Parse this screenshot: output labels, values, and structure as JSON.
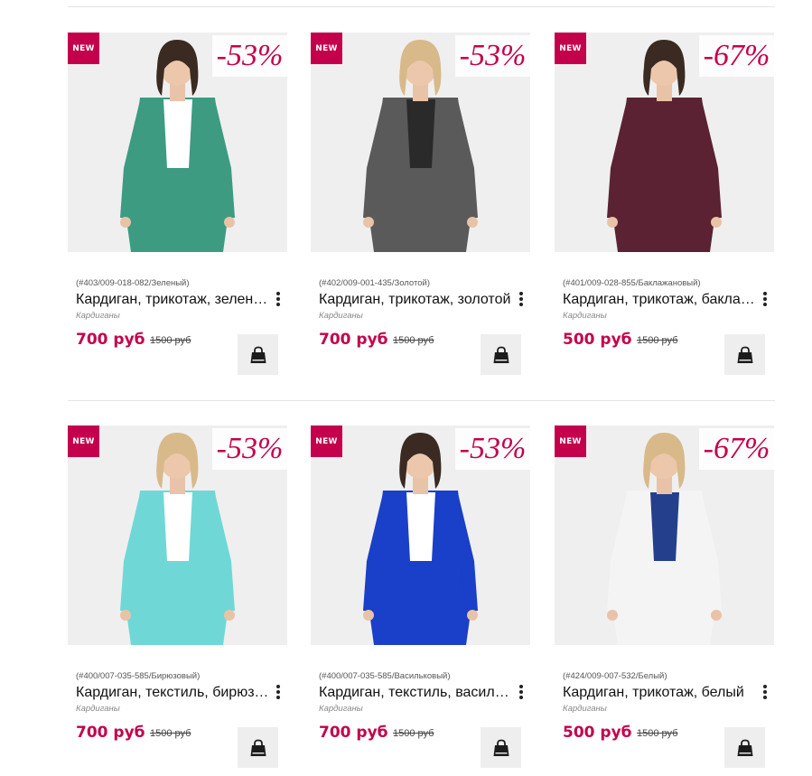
{
  "colors": {
    "accent": "#c4004c",
    "badge_text": "#ffffff",
    "button_bg": "#eeeeee"
  },
  "products": [
    {
      "badge": "NEW",
      "discount": "-53%",
      "sku": "(#403/009-018-082/Зеленый)",
      "title": "Кардиган, трикотаж, зеленый",
      "category": "Кардиганы",
      "price": "700 руб",
      "old_price": "1500 руб",
      "garment_color": "#3d9b82",
      "inner_color": "#ffffff",
      "bottom_color": "#3d9b82"
    },
    {
      "badge": "NEW",
      "discount": "-53%",
      "sku": "(#402/009-001-435/Золотой)",
      "title": "Кардиган, трикотаж, золотой",
      "category": "Кардиганы",
      "price": "700 руб",
      "old_price": "1500 руб",
      "garment_color": "#5a5a5a",
      "inner_color": "#2a2a2a",
      "bottom_color": "#2a2a2a"
    },
    {
      "badge": "NEW",
      "discount": "-67%",
      "sku": "(#401/009-028-855/Баклажановый)",
      "title": "Кардиган, трикотаж, баклажановый",
      "category": "Кардиганы",
      "price": "500 руб",
      "old_price": "1500 руб",
      "garment_color": "#5a2232",
      "inner_color": "#5a2232",
      "bottom_color": "#d8c7bd"
    },
    {
      "badge": "NEW",
      "discount": "-53%",
      "sku": "(#400/007-035-585/Бирюзовый)",
      "title": "Кардиган, текстиль, бирюзовый",
      "category": "Кардиганы",
      "price": "700 руб",
      "old_price": "1500 руб",
      "garment_color": "#6fd8d6",
      "inner_color": "#ffffff",
      "bottom_color": "#6fd8d6"
    },
    {
      "badge": "NEW",
      "discount": "-53%",
      "sku": "(#400/007-035-585/Васильковый)",
      "title": "Кардиган, текстиль, васильковый",
      "category": "Кардиганы",
      "price": "700 руб",
      "old_price": "1500 руб",
      "garment_color": "#1a3fc8",
      "inner_color": "#ffffff",
      "bottom_color": "#1a3fc8"
    },
    {
      "badge": "NEW",
      "discount": "-67%",
      "sku": "(#424/009-007-532/Белый)",
      "title": "Кардиган, трикотаж, белый",
      "category": "Кардиганы",
      "price": "500 руб",
      "old_price": "1500 руб",
      "garment_color": "#f4f4f4",
      "inner_color": "#24408c",
      "bottom_color": "#1f47b0"
    }
  ],
  "icons": {
    "more": "vertical-dots-icon",
    "cart": "shopping-bag-icon"
  }
}
